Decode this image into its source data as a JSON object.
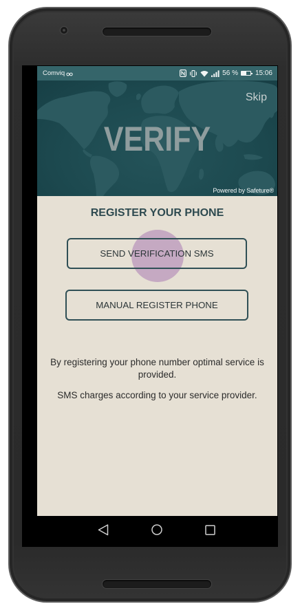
{
  "status_bar": {
    "carrier": "Comviq",
    "battery_percent": "56 %",
    "battery_level": 0.56,
    "time": "15:06",
    "icons": {
      "network": "network-type-icon",
      "nfc": "nfc-icon",
      "vibrate": "vibrate-icon",
      "wifi": "wifi-icon",
      "signal": "signal-icon",
      "battery": "battery-icon"
    }
  },
  "header": {
    "skip_label": "Skip",
    "title": "VERIFY",
    "powered_by": "Powered by Safeture®"
  },
  "register": {
    "heading": "REGISTER YOUR PHONE",
    "send_sms_button": "SEND VERIFICATION SMS",
    "manual_register_button": "MANUAL REGISTER PHONE",
    "info_text": "By registering your phone number optimal service is provided.",
    "charges_text": "SMS charges according to your service provider."
  },
  "nav_bar": {
    "back": "back-icon",
    "home": "home-icon",
    "recents": "recents-icon"
  },
  "colors": {
    "status_bar": "#35656a",
    "header": "#1d4a50",
    "map": "#2c5a60",
    "body": "#e6e0d4",
    "accent": "#2f4f55",
    "ripple": "#a068ad",
    "text": "#2b2b2b"
  }
}
